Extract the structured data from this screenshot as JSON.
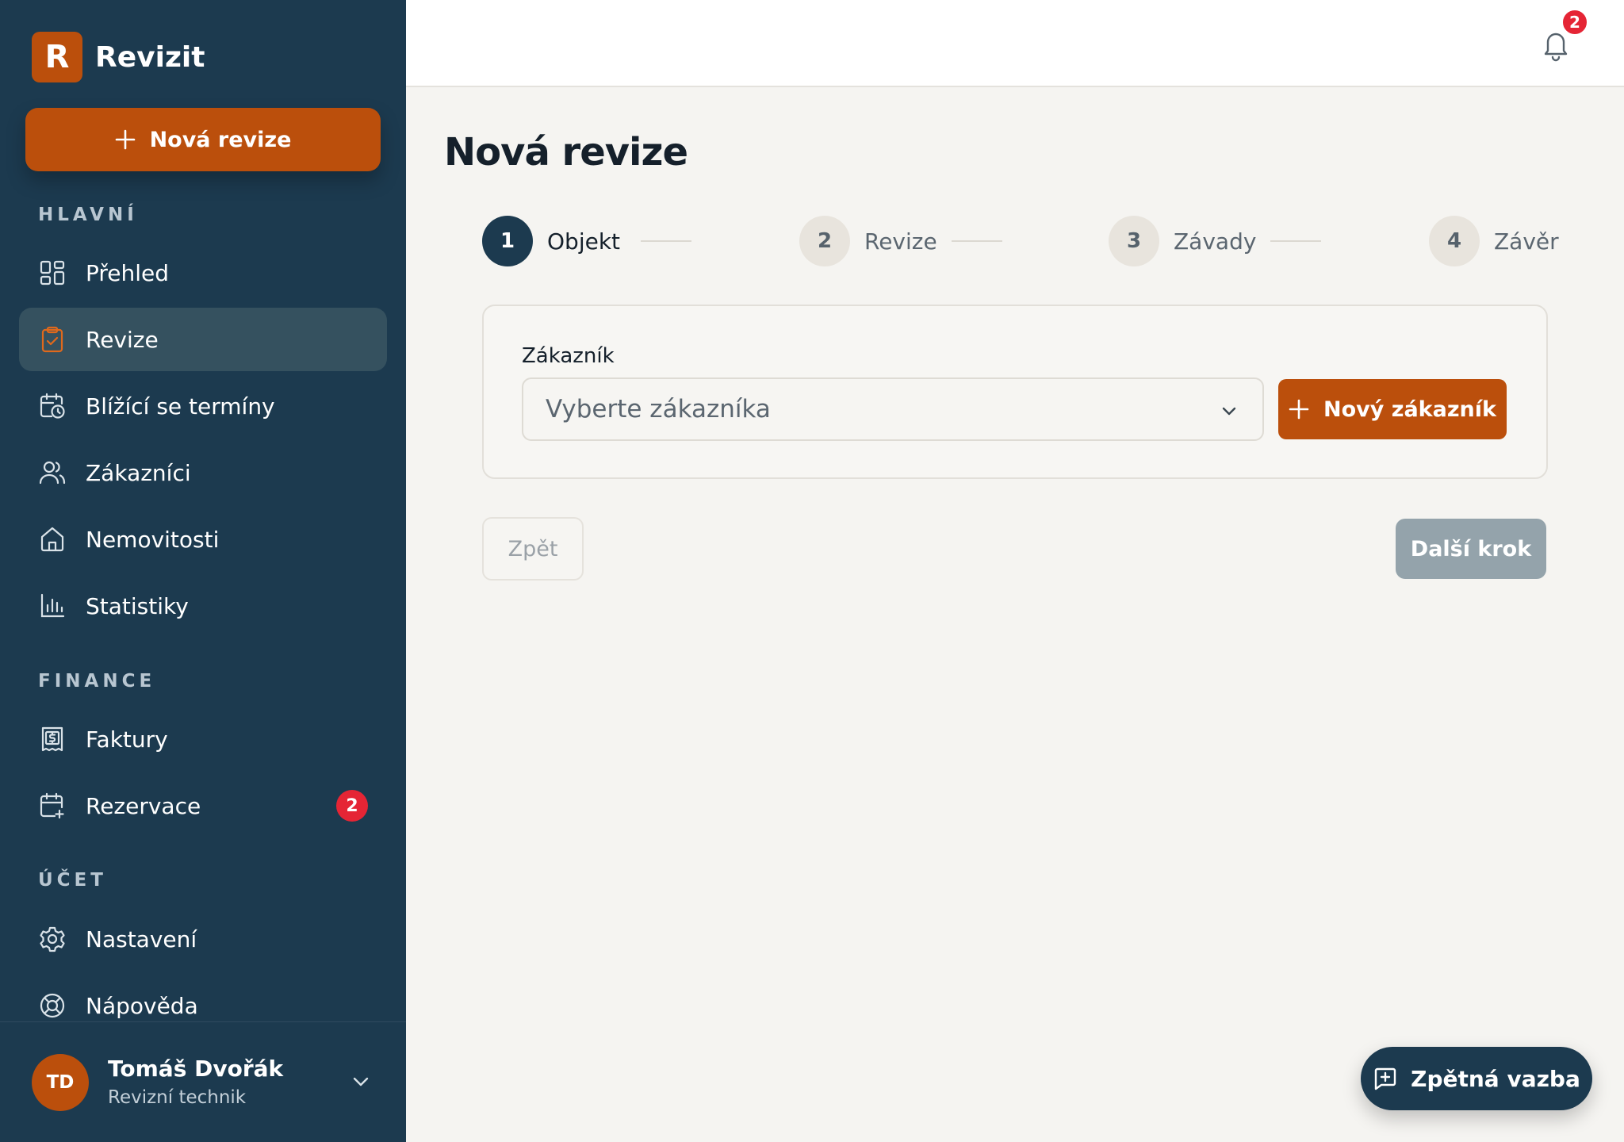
{
  "brand": {
    "logo_letter": "R",
    "name": "Revizit",
    "accent": "#bb4f0c",
    "sidebar_bg": "#1c3a4f"
  },
  "sidebar": {
    "new_button_label": "Nová revize",
    "sections": {
      "main": "HLAVNÍ",
      "finance": "FINANCE",
      "account": "ÚČET"
    },
    "items": [
      {
        "label": "Přehled",
        "icon": "dashboard-icon"
      },
      {
        "label": "Revize",
        "icon": "clipboard-check-icon",
        "active": true
      },
      {
        "label": "Blížící se termíny",
        "icon": "calendar-clock-icon"
      },
      {
        "label": "Zákazníci",
        "icon": "users-icon"
      },
      {
        "label": "Nemovitosti",
        "icon": "home-icon"
      },
      {
        "label": "Statistiky",
        "icon": "bar-chart-icon"
      },
      {
        "label": "Faktury",
        "icon": "invoice-icon"
      },
      {
        "label": "Rezervace",
        "icon": "calendar-plus-icon",
        "badge": "2"
      },
      {
        "label": "Nastavení",
        "icon": "gear-icon"
      },
      {
        "label": "Nápověda",
        "icon": "lifebuoy-icon"
      }
    ]
  },
  "user": {
    "initials": "TD",
    "name": "Tomáš Dvořák",
    "role": "Revizní technik"
  },
  "topbar": {
    "notification_count": "2"
  },
  "main": {
    "title": "Nová revize",
    "steps": [
      {
        "number": "1",
        "label": "Objekt",
        "active": true
      },
      {
        "number": "2",
        "label": "Revize"
      },
      {
        "number": "3",
        "label": "Závady"
      },
      {
        "number": "4",
        "label": "Závěr"
      }
    ],
    "form": {
      "customer_label": "Zákazník",
      "customer_placeholder": "Vyberte zákazníka",
      "new_customer_label": "Nový zákazník"
    },
    "back_label": "Zpět",
    "next_label": "Další krok"
  },
  "feedback_label": "Zpětná vazba"
}
